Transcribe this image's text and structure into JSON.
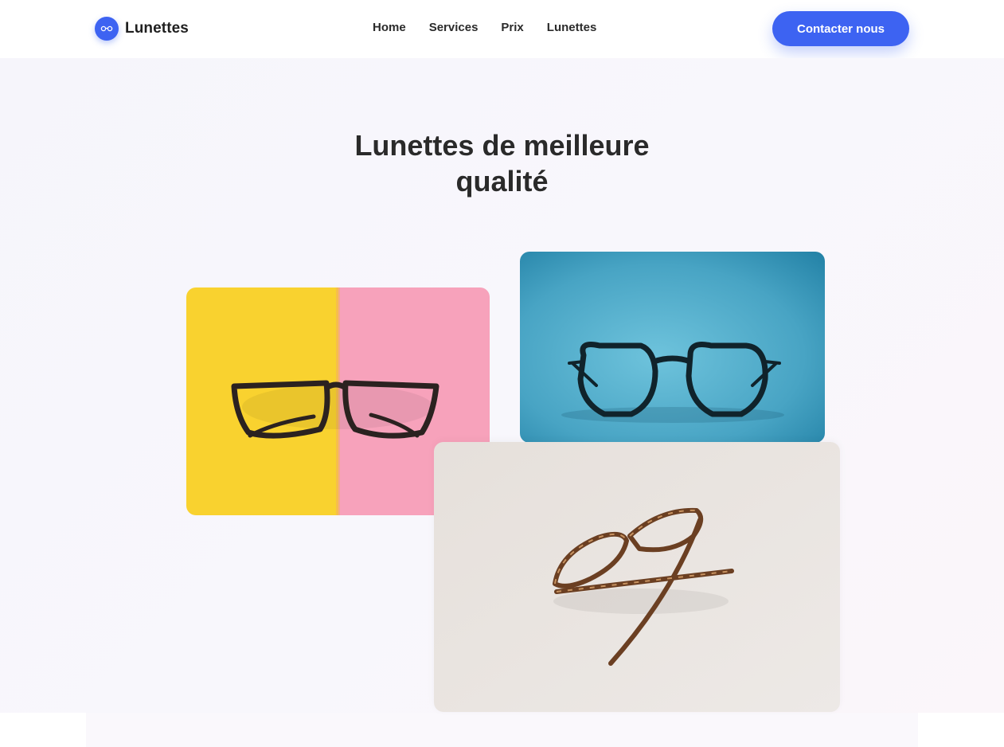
{
  "brand": {
    "name": "Lunettes",
    "logo_icon": "glasses-icon",
    "accent_color": "#3d63f2"
  },
  "nav": {
    "items": [
      {
        "label": "Home"
      },
      {
        "label": "Services"
      },
      {
        "label": "Prix"
      },
      {
        "label": "Lunettes"
      }
    ]
  },
  "cta": {
    "label": "Contacter nous"
  },
  "hero": {
    "title_line1": "Lunettes de meilleure",
    "title_line2": "qualité"
  },
  "gallery": {
    "images": [
      {
        "icon": "black-glasses-on-yellow-pink-image",
        "colors": [
          "#f9d22f",
          "#f7a2bb"
        ]
      },
      {
        "icon": "black-glasses-on-blue-image",
        "colors": [
          "#4fa9c8"
        ]
      },
      {
        "icon": "tortoiseshell-glasses-on-beige-image",
        "colors": [
          "#e8e3df"
        ]
      }
    ]
  }
}
